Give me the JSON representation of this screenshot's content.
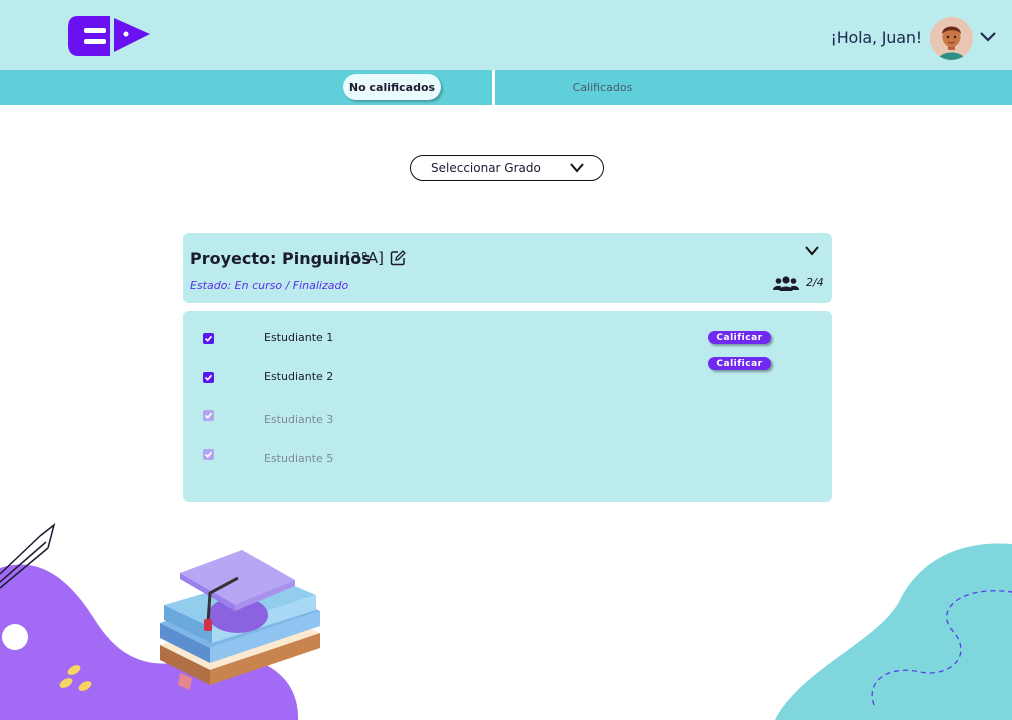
{
  "header": {
    "greeting": "¡Hola, Juan!",
    "colors": {
      "header_bg": "#bcebee",
      "brand": "#6a11f2"
    }
  },
  "tabs": [
    {
      "label": "No calificados",
      "active": true
    },
    {
      "label": "Calificados",
      "active": false
    }
  ],
  "filter": {
    "selected": "Seleccionar Grado"
  },
  "project": {
    "title": "Proyecto: Pinguinos",
    "grade": "[3°A]",
    "status": "Estado: En curso / Finalizado",
    "count": "2/4"
  },
  "students": [
    {
      "name": "Estudiante 1",
      "checked": true,
      "enabled": true,
      "action": "Calificar"
    },
    {
      "name": "Estudiante 2",
      "checked": true,
      "enabled": true,
      "action": "Calificar"
    },
    {
      "name": "Estudiante 3",
      "checked": true,
      "enabled": false,
      "action": ""
    },
    {
      "name": "Estudiante 5",
      "checked": true,
      "enabled": false,
      "action": ""
    }
  ]
}
